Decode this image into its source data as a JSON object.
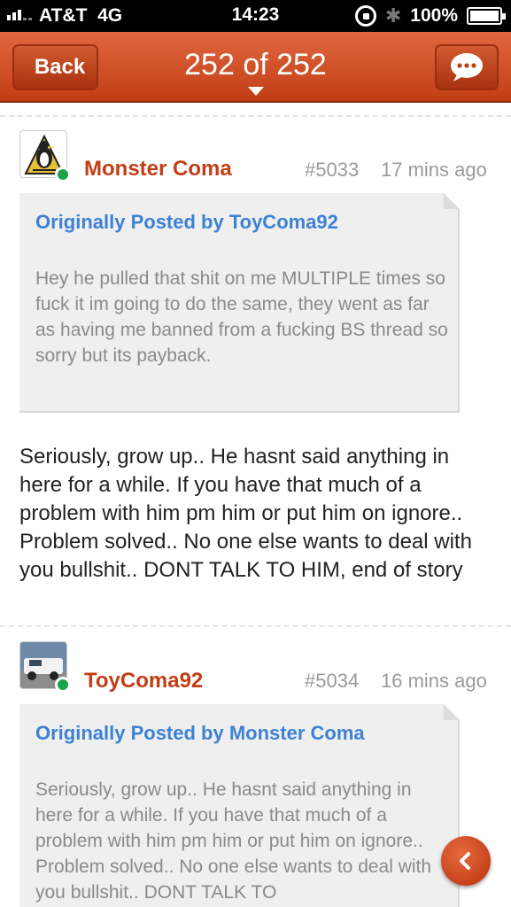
{
  "status_bar": {
    "carrier": "AT&T",
    "network": "4G",
    "time": "14:23",
    "battery": "100%",
    "icons": [
      "signal-icon",
      "rotation-lock-icon",
      "bluetooth-icon",
      "battery-icon"
    ]
  },
  "nav": {
    "back_label": "Back",
    "title": "252 of 252",
    "chat_icon": "chat-bubble-icon"
  },
  "posts": [
    {
      "username": "Monster Coma",
      "post_number": "#5033",
      "time_ago": "17 mins ago",
      "avatar": "penguins-logo",
      "online": true,
      "quote": {
        "header": "Originally Posted by ToyComa92",
        "text": "Hey he pulled that shit on me MULTIPLE times so fuck it im going to do the same, they went as far as having me banned from a fucking BS thread so sorry but its payback."
      },
      "body": "Seriously, grow up.. He hasnt said anything in here for a while.  If you have that much of a problem with him pm him or put him on ignore.. Problem solved.. No one else wants to deal with you bullshit.. DONT TALK TO HIM, end of story"
    },
    {
      "username": "ToyComa92",
      "post_number": "#5034",
      "time_ago": "16 mins ago",
      "avatar": "truck-photo",
      "online": true,
      "quote": {
        "header": "Originally Posted by Monster Coma",
        "text": "Seriously, grow up.. He hasnt said anything in here for a while.  If you have that much of a problem with him pm him or put him on ignore.. Problem solved.. No one else wants to deal with you bullshit.. DONT TALK TO"
      }
    }
  ],
  "floating_button_icon": "chevron-left-icon",
  "colors": {
    "nav_red": "#c94a20",
    "username": "#c23e15",
    "quote_header": "#3d82d4",
    "online": "#1aa34a"
  }
}
